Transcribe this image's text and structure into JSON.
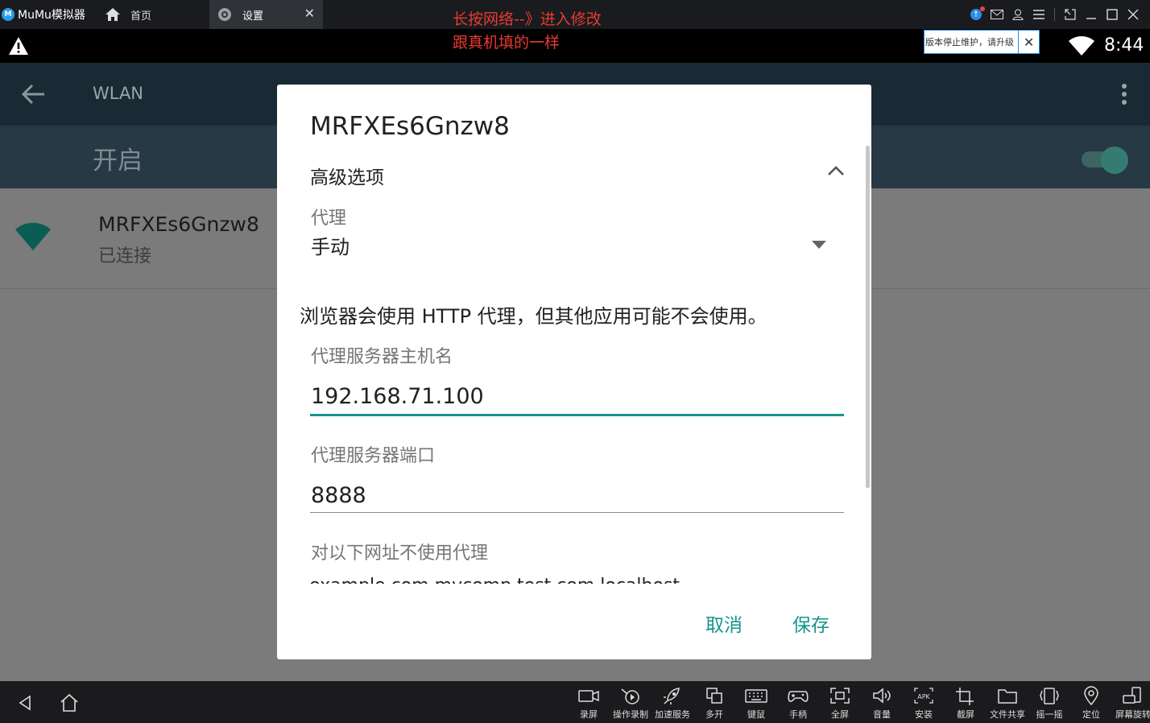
{
  "titlebar": {
    "app_name": "MuMu模拟器",
    "home_tab_label": "首页",
    "active_tab_label": "设置",
    "tab_close": "✕"
  },
  "statusbar": {
    "annotation_line1": "长按网络--》进入修改",
    "annotation_line2": "跟真机填的一样",
    "notice_text": "版本停止维护，请升级",
    "notice_close": "✕",
    "time": "8:44"
  },
  "appbar": {
    "title": "WLAN"
  },
  "switchbar": {
    "label": "开启",
    "toggle_on": true
  },
  "network": {
    "ssid": "MRFXEs6Gnzw8",
    "status": "已连接"
  },
  "dialog": {
    "title": "MRFXEs6Gnzw8",
    "advanced_label": "高级选项",
    "proxy_label": "代理",
    "proxy_value": "手动",
    "proxy_note": "浏览器会使用 HTTP 代理，但其他应用可能不会使用。",
    "host_label": "代理服务器主机名",
    "host_value": "192.168.71.100",
    "port_label": "代理服务器端口",
    "port_value": "8888",
    "bypass_label": "对以下网址不使用代理",
    "bypass_value": "example.com,mycomp.test.com,localhost",
    "cancel_label": "取消",
    "save_label": "保存"
  },
  "toolbar": {
    "tools": [
      {
        "label": "录屏",
        "icon": "video-record-icon"
      },
      {
        "label": "操作录制",
        "icon": "macro-record-icon"
      },
      {
        "label": "加速服务",
        "icon": "rocket-icon"
      },
      {
        "label": "多开",
        "icon": "multi-instance-icon"
      },
      {
        "label": "键鼠",
        "icon": "keyboard-icon"
      },
      {
        "label": "手柄",
        "icon": "gamepad-icon"
      },
      {
        "label": "全屏",
        "icon": "fullscreen-icon"
      },
      {
        "label": "音量",
        "icon": "volume-icon"
      },
      {
        "label": "安装",
        "icon": "apk-install-icon"
      },
      {
        "label": "截屏",
        "icon": "crop-screenshot-icon"
      },
      {
        "label": "文件共享",
        "icon": "folder-icon"
      },
      {
        "label": "摇一摇",
        "icon": "shake-icon"
      },
      {
        "label": "定位",
        "icon": "location-pin-icon"
      },
      {
        "label": "屏幕旋转",
        "icon": "rotate-screen-icon"
      }
    ]
  },
  "colors": {
    "accent": "#17958d",
    "annotation": "#e83b2f",
    "notice_border": "#2a8de8"
  }
}
